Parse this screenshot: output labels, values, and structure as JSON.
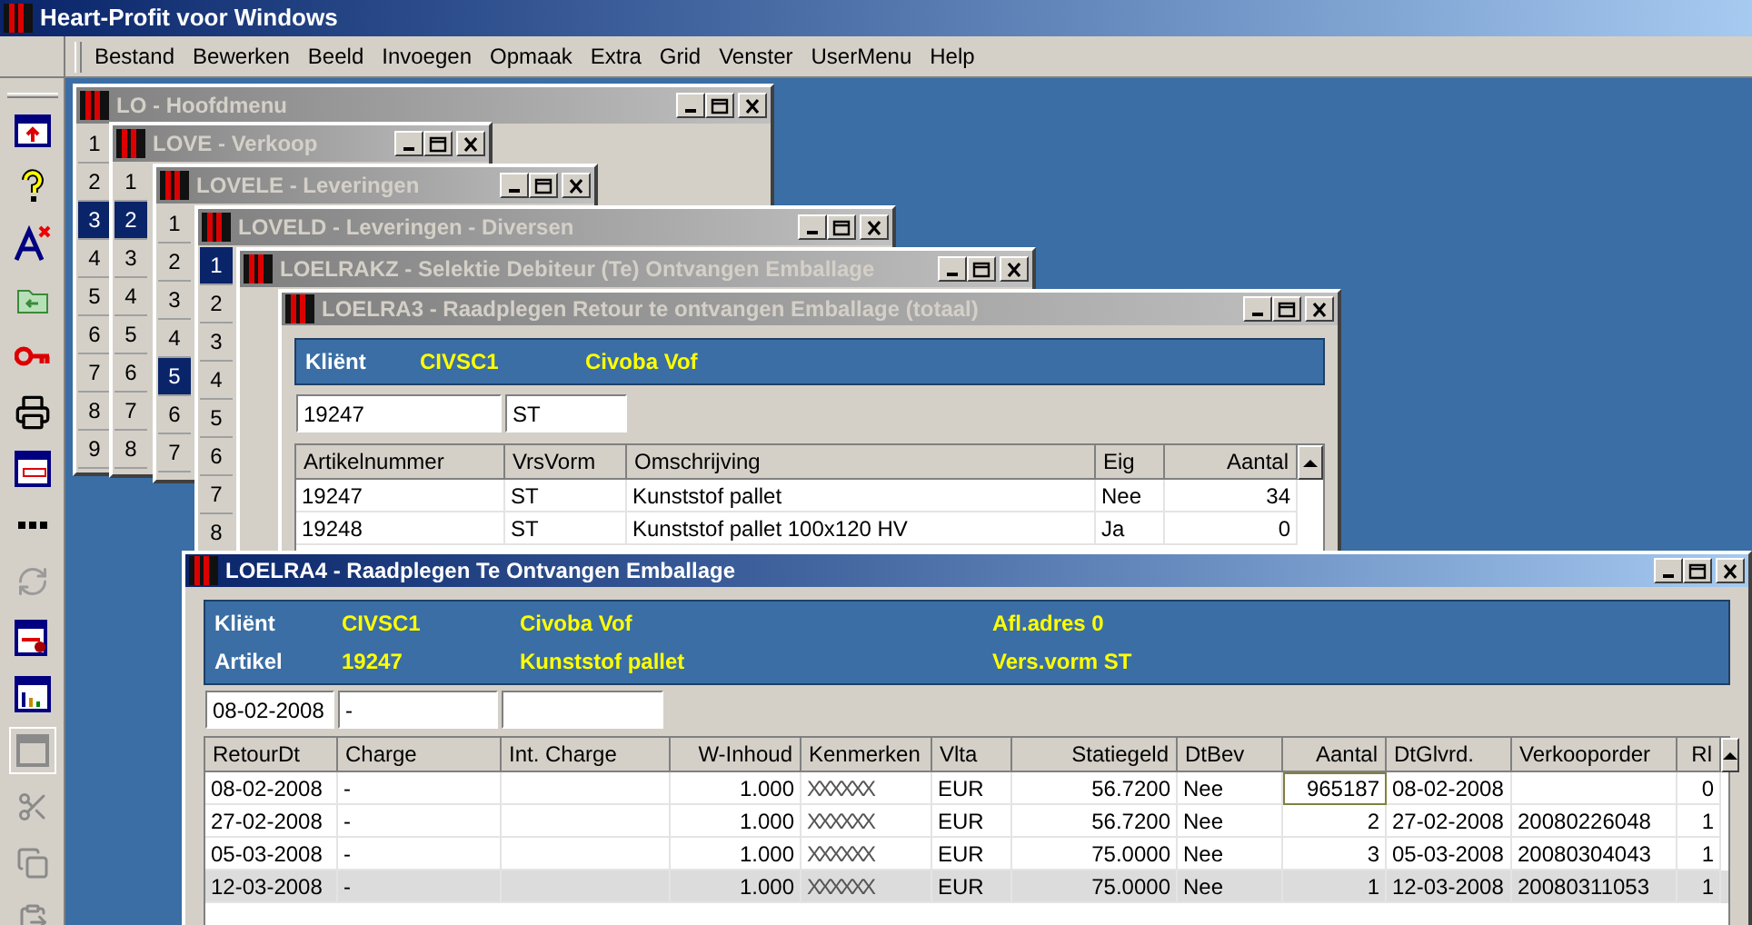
{
  "app_title": "Heart-Profit voor Windows",
  "menu": [
    "Bestand",
    "Bewerken",
    "Beeld",
    "Invoegen",
    "Opmaak",
    "Extra",
    "Grid",
    "Venster",
    "UserMenu",
    "Help"
  ],
  "windows": [
    {
      "kind": "menu",
      "title": "LO - Hoofdmenu",
      "active": false,
      "items": [
        {
          "label": "1",
          "selected": false
        },
        {
          "label": "2",
          "selected": false
        },
        {
          "label": "3",
          "selected": true
        },
        {
          "label": "4",
          "selected": false
        },
        {
          "label": "5",
          "selected": false
        },
        {
          "label": "6",
          "selected": false
        },
        {
          "label": "7",
          "selected": false
        },
        {
          "label": "8",
          "selected": false
        },
        {
          "label": "9",
          "selected": false
        }
      ]
    },
    {
      "kind": "menu",
      "title": "LOVE - Verkoop",
      "active": false,
      "items": [
        {
          "label": "1",
          "selected": false
        },
        {
          "label": "2",
          "selected": true
        },
        {
          "label": "3",
          "selected": false
        },
        {
          "label": "4",
          "selected": false
        },
        {
          "label": "5",
          "selected": false
        },
        {
          "label": "6",
          "selected": false
        },
        {
          "label": "7",
          "selected": false
        },
        {
          "label": "8",
          "selected": false
        }
      ]
    },
    {
      "kind": "menu",
      "title": "LOVELE - Leveringen",
      "active": false,
      "items": [
        {
          "label": "1",
          "selected": false
        },
        {
          "label": "2",
          "selected": false
        },
        {
          "label": "3",
          "selected": false
        },
        {
          "label": "4",
          "selected": false
        },
        {
          "label": "5",
          "selected": true
        },
        {
          "label": "6",
          "selected": false
        },
        {
          "label": "7",
          "selected": false
        }
      ]
    },
    {
      "kind": "menu",
      "title": "LOVELD - Leveringen - Diversen",
      "active": false,
      "items": [
        {
          "label": "1",
          "selected": true
        },
        {
          "label": "2",
          "selected": false
        },
        {
          "label": "3",
          "selected": false
        },
        {
          "label": "4",
          "selected": false
        },
        {
          "label": "5",
          "selected": false
        },
        {
          "label": "6",
          "selected": false
        },
        {
          "label": "7",
          "selected": false
        },
        {
          "label": "8",
          "selected": false
        }
      ]
    },
    {
      "kind": "blank",
      "title": "LOELRAKZ - Selektie Debiteur (Te) Ontvangen Emballage",
      "active": false
    },
    {
      "kind": "grid",
      "title": "LOELRA3 - Raadplegen Retour te ontvangen Emballage (totaal)",
      "active": false,
      "header": [
        [
          {
            "kind": "label",
            "text": "Kliënt"
          },
          {
            "kind": "value",
            "text": "CIVSC1"
          },
          {
            "kind": "value",
            "text": "Civoba Vof"
          }
        ]
      ],
      "fields": [
        {
          "kind": "text",
          "value": "19247"
        },
        {
          "kind": "text",
          "value": "ST"
        }
      ],
      "columns": [
        {
          "label": "Artikelnummer",
          "kind": "text"
        },
        {
          "label": "VrsVorm",
          "kind": "text"
        },
        {
          "label": "Omschrijving",
          "kind": "text"
        },
        {
          "label": "Eig",
          "kind": "text"
        },
        {
          "label": "Aantal",
          "kind": "number"
        }
      ],
      "rows": [
        {
          "selected": false,
          "cells": [
            {
              "text": "19247",
              "focused": false
            },
            {
              "text": "ST",
              "focused": false
            },
            {
              "text": "Kunststof pallet",
              "focused": false
            },
            {
              "text": "Nee",
              "focused": false
            },
            {
              "text": "34",
              "focused": false
            }
          ]
        },
        {
          "selected": false,
          "cells": [
            {
              "text": "19248",
              "focused": false
            },
            {
              "text": "ST",
              "focused": false
            },
            {
              "text": "Kunststof pallet 100x120 HV",
              "focused": false
            },
            {
              "text": "Ja",
              "focused": false
            },
            {
              "text": "0",
              "focused": false
            }
          ]
        }
      ]
    },
    {
      "kind": "grid",
      "title": "LOELRA4 - Raadplegen Te Ontvangen Emballage",
      "active": true,
      "header": [
        [
          {
            "kind": "label",
            "text": "Kliënt"
          },
          {
            "kind": "value",
            "text": "CIVSC1"
          },
          {
            "kind": "value",
            "text": "Civoba Vof"
          },
          {
            "kind": "value",
            "text": "Afl.adres 0"
          }
        ],
        [
          {
            "kind": "label",
            "text": "Artikel"
          },
          {
            "kind": "value",
            "text": "19247"
          },
          {
            "kind": "value",
            "text": "Kunststof pallet"
          },
          {
            "kind": "value",
            "text": "Vers.vorm ST"
          }
        ]
      ],
      "fields": [
        {
          "kind": "text",
          "value": "08-02-2008"
        },
        {
          "kind": "text",
          "value": "-"
        },
        {
          "kind": "empty"
        }
      ],
      "columns": [
        {
          "label": "RetourDt",
          "kind": "text"
        },
        {
          "label": "Charge",
          "kind": "text"
        },
        {
          "label": "Int. Charge",
          "kind": "text"
        },
        {
          "label": "W-Inhoud",
          "kind": "number"
        },
        {
          "label": "Kenmerken",
          "kind": "text"
        },
        {
          "label": "Vlta",
          "kind": "text"
        },
        {
          "label": "Statiegeld",
          "kind": "number"
        },
        {
          "label": "DtBev",
          "kind": "text"
        },
        {
          "label": "Aantal",
          "kind": "number"
        },
        {
          "label": "DtGlvrd.",
          "kind": "text"
        },
        {
          "label": "Verkooporder",
          "kind": "text"
        },
        {
          "label": "Rl",
          "kind": "number"
        }
      ],
      "rows": [
        {
          "selected": false,
          "cells": [
            {
              "text": "08-02-2008",
              "focused": false
            },
            {
              "text": "-",
              "focused": false
            },
            {
              "focused": false
            },
            {
              "text": "1.000",
              "focused": false
            },
            {
              "text": "XXXXXX",
              "focused": false
            },
            {
              "text": "EUR",
              "focused": false
            },
            {
              "text": "56.7200",
              "focused": false
            },
            {
              "text": "Nee",
              "focused": false
            },
            {
              "text": "965187",
              "focused": true
            },
            {
              "text": "08-02-2008",
              "focused": false
            },
            {
              "focused": false
            },
            {
              "text": "0",
              "focused": false
            }
          ]
        },
        {
          "selected": false,
          "cells": [
            {
              "text": "27-02-2008",
              "focused": false
            },
            {
              "text": "-",
              "focused": false
            },
            {
              "focused": false
            },
            {
              "text": "1.000",
              "focused": false
            },
            {
              "text": "XXXXXX",
              "focused": false
            },
            {
              "text": "EUR",
              "focused": false
            },
            {
              "text": "56.7200",
              "focused": false
            },
            {
              "text": "Nee",
              "focused": false
            },
            {
              "text": "2",
              "focused": false
            },
            {
              "text": "27-02-2008",
              "focused": false
            },
            {
              "text": "20080226048",
              "focused": false
            },
            {
              "text": "1",
              "focused": false
            }
          ]
        },
        {
          "selected": false,
          "cells": [
            {
              "text": "05-03-2008",
              "focused": false
            },
            {
              "text": "-",
              "focused": false
            },
            {
              "focused": false
            },
            {
              "text": "1.000",
              "focused": false
            },
            {
              "text": "XXXXXX",
              "focused": false
            },
            {
              "text": "EUR",
              "focused": false
            },
            {
              "text": "75.0000",
              "focused": false
            },
            {
              "text": "Nee",
              "focused": false
            },
            {
              "text": "3",
              "focused": false
            },
            {
              "text": "05-03-2008",
              "focused": false
            },
            {
              "text": "20080304043",
              "focused": false
            },
            {
              "text": "1",
              "focused": false
            }
          ]
        },
        {
          "selected": true,
          "cells": [
            {
              "text": "12-03-2008",
              "focused": false
            },
            {
              "text": "-",
              "focused": false
            },
            {
              "focused": false
            },
            {
              "text": "1.000",
              "focused": false
            },
            {
              "text": "XXXXXX",
              "focused": false
            },
            {
              "text": "EUR",
              "focused": false
            },
            {
              "text": "75.0000",
              "focused": false
            },
            {
              "text": "Nee",
              "focused": false
            },
            {
              "text": "1",
              "focused": false
            },
            {
              "text": "12-03-2008",
              "focused": false
            },
            {
              "text": "20080311053",
              "focused": false
            },
            {
              "text": "1",
              "focused": false
            }
          ]
        }
      ]
    }
  ]
}
